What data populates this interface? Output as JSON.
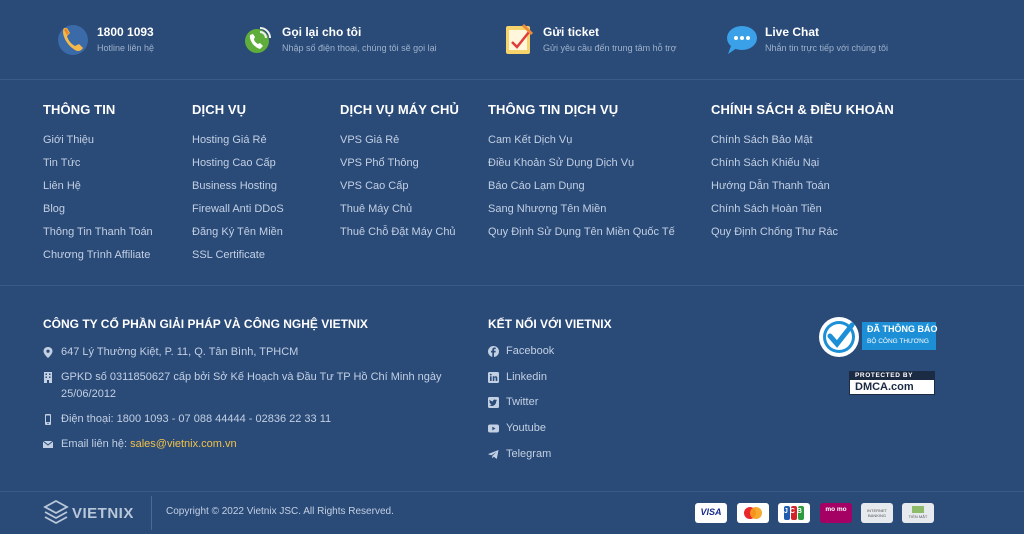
{
  "contacts": [
    {
      "title": "1800 1093",
      "subtitle": "Hotline liên hệ",
      "icon": "phone-icon"
    },
    {
      "title": "Gọi lại cho tôi",
      "subtitle": "Nhập số điện thoại, chúng tôi sẽ gọi lại",
      "icon": "callback-icon"
    },
    {
      "title": "Gửi ticket",
      "subtitle": "Gửi yêu cầu đến trung tâm hỗ trợ",
      "icon": "ticket-icon"
    },
    {
      "title": "Live Chat",
      "subtitle": "Nhắn tin trực tiếp với chúng tôi",
      "icon": "chat-icon"
    }
  ],
  "menus": [
    {
      "title": "THÔNG TIN",
      "items": [
        "Giới Thiệu",
        "Tin Tức",
        "Liên Hệ",
        "Blog",
        "Thông Tin Thanh Toán",
        "Chương Trình Affiliate"
      ]
    },
    {
      "title": "DỊCH VỤ",
      "items": [
        "Hosting Giá Rẻ",
        "Hosting Cao Cấp",
        "Business Hosting",
        "Firewall Anti DDoS",
        "Đăng Ký Tên Miền",
        "SSL Certificate"
      ]
    },
    {
      "title": "DỊCH VỤ MÁY CHỦ",
      "items": [
        "VPS Giá Rẻ",
        "VPS Phổ Thông",
        "VPS Cao Cấp",
        "Thuê Máy Chủ",
        "Thuê Chỗ Đặt Máy Chủ"
      ]
    },
    {
      "title": "THÔNG TIN DỊCH VỤ",
      "items": [
        "Cam Kết Dịch Vụ",
        "Điều Khoản Sử Dụng Dịch Vụ",
        "Báo Cáo Lạm Dụng",
        "Sang Nhượng Tên Miền",
        "Quy Định Sử Dụng Tên Miền Quốc Tế"
      ]
    },
    {
      "title": "CHÍNH SÁCH & ĐIỀU KHOẢN",
      "items": [
        "Chính Sách Bảo Mật",
        "Chính Sách Khiếu Nại",
        "Hướng Dẫn Thanh Toán",
        "Chính Sách Hoàn Tiền",
        "Quy Định Chống Thư Rác"
      ]
    }
  ],
  "company": {
    "name": "CÔNG TY CỔ PHẦN GIẢI PHÁP VÀ CÔNG NGHỆ VIETNIX",
    "address": "647 Lý Thường Kiệt, P. 11, Q. Tân Bình, TPHCM",
    "license": "GPKD số 0311850627 cấp bởi Sở Kế Hoạch và Đầu Tư TP Hồ Chí Minh ngày 25/06/2012",
    "phone": "Điện thoại: 1800 1093 - 07 088 44444 - 02836 22 33 11",
    "email_label": "Email liên hệ: ",
    "email": "sales@vietnix.com.vn"
  },
  "social": {
    "title": "KẾT NỐI VỚI VIETNIX",
    "items": [
      {
        "label": "Facebook",
        "icon": "facebook-icon"
      },
      {
        "label": "Linkedin",
        "icon": "linkedin-icon"
      },
      {
        "label": "Twitter",
        "icon": "twitter-icon"
      },
      {
        "label": "Youtube",
        "icon": "youtube-icon"
      },
      {
        "label": "Telegram",
        "icon": "telegram-icon"
      }
    ]
  },
  "badges": {
    "bct_line1": "ĐÃ THÔNG BÁO",
    "bct_line2": "BỘ CÔNG THƯƠNG",
    "dmca_line1": "PROTECTED BY",
    "dmca_line2": "DMCA.com"
  },
  "bottom": {
    "logo_text": "VIETNIX",
    "copyright": "Copyright © 2022 Vietnix JSC. All Rights Reserved.",
    "payments": [
      {
        "label": "VISA",
        "icon": "visa-icon"
      },
      {
        "label": "",
        "icon": "mastercard-icon"
      },
      {
        "label": "JCB",
        "icon": "jcb-icon"
      },
      {
        "label": "mo mo",
        "icon": "momo-icon"
      },
      {
        "label": "INTERNET BANKING",
        "icon": "internet-banking-icon"
      },
      {
        "label": "TIỀN MẶT",
        "icon": "cash-icon"
      }
    ]
  },
  "colors": {
    "background": "#2a4a78",
    "accent_email": "#f1c24a",
    "bct_badge": "#1c8fd6"
  }
}
